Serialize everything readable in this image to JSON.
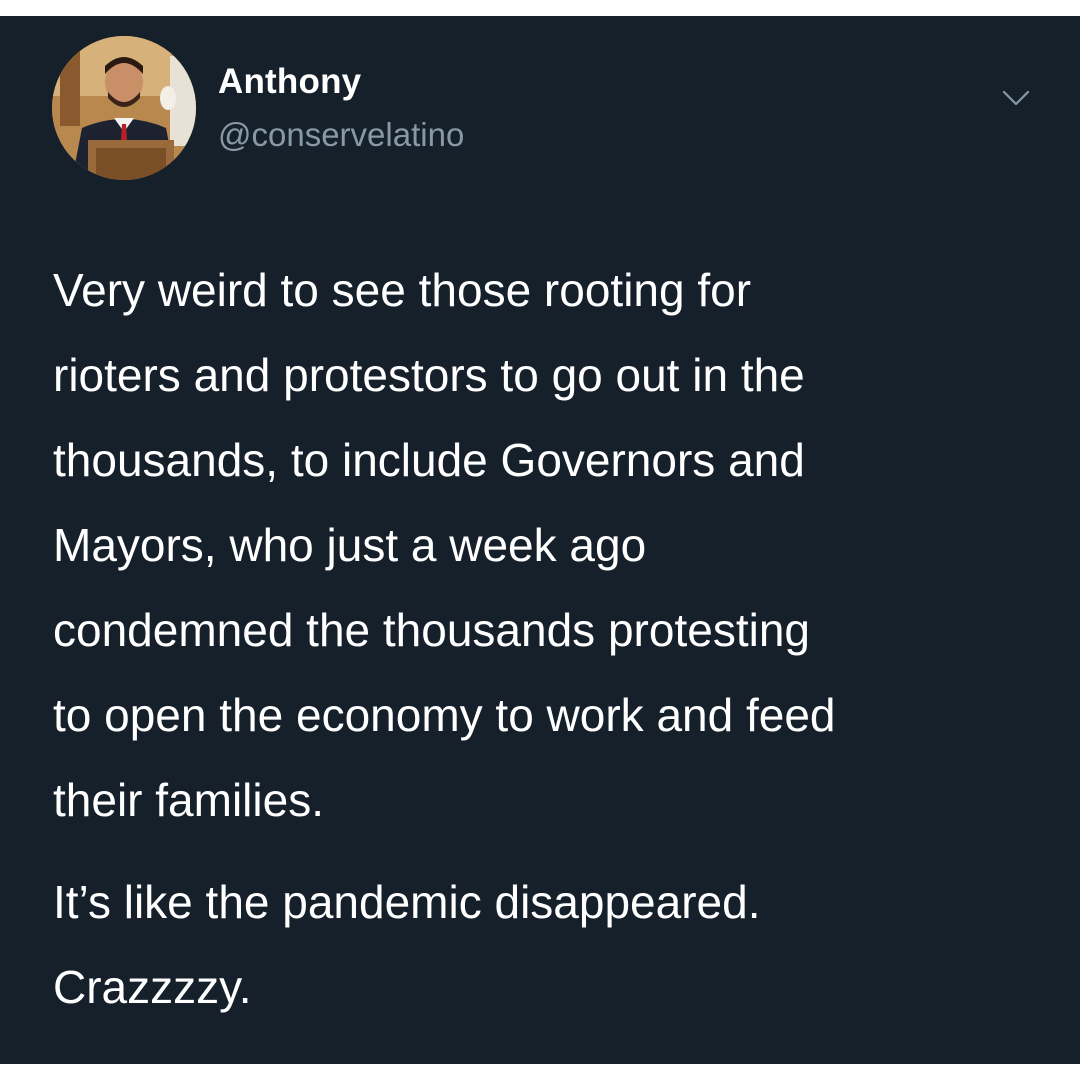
{
  "tweet": {
    "author": {
      "name": "Anthony",
      "handle": "@conservelatino",
      "avatar_icon": "profile-photo"
    },
    "menu_icon": "chevron-down-icon",
    "paragraphs": [
      "Very weird to see those rooting for\nrioters and protestors to go out in the\nthousands, to include Governors and\nMayors, who just a week ago\ncondemned the thousands protesting\nto open the economy to work and feed\ntheir families.",
      "It’s like the pandemic disappeared.\nCrazzzzy."
    ]
  },
  "colors": {
    "background": "#15202b",
    "text_primary": "#ffffff",
    "text_secondary": "#8899a6"
  }
}
